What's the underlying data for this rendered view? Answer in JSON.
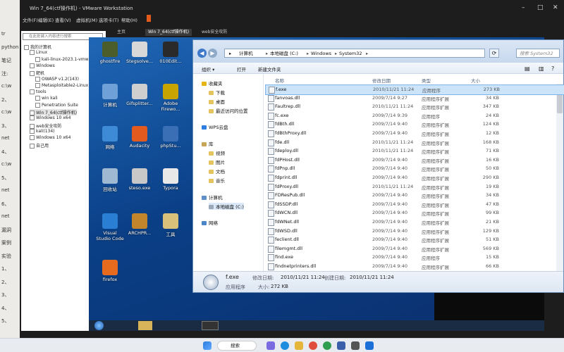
{
  "host_left": {
    "lines": [
      "tr",
      "python pc",
      "笔记",
      "注:",
      "c:\\w",
      "2、",
      "c:\\w",
      "3、",
      "net",
      "4、",
      "c:\\w",
      "5、",
      "net",
      "6、",
      "net",
      "漏洞",
      "案例",
      "实验",
      "1、",
      "2、",
      "3、",
      "4、",
      "5、"
    ]
  },
  "vmware": {
    "title": "Win 7_64(ctf操作机) - VMware Workstation",
    "menu": [
      "文件(F)",
      "编辑(E)",
      "查看(V)",
      "虚拟机(M)",
      "选项卡(T)",
      "帮助(H)"
    ],
    "library_search_placeholder": "在此处键入内容进行搜索",
    "tree": [
      {
        "label": "我的计算机",
        "level": 0
      },
      {
        "label": "Linux",
        "level": 1
      },
      {
        "label": "kali-linux-2023.1-vmware-amd",
        "level": 2
      },
      {
        "label": "Windows",
        "level": 1
      },
      {
        "label": "靶机",
        "level": 1
      },
      {
        "label": "OWASP v1.2(143)",
        "level": 2
      },
      {
        "label": "Metasploitable2-Linux",
        "level": 2
      },
      {
        "label": "tools",
        "level": 1
      },
      {
        "label": "win kali",
        "level": 2
      },
      {
        "label": "Penetration Suite",
        "level": 2
      },
      {
        "label": "Win 7_64(ctf操作机)",
        "level": 1
      },
      {
        "label": "Windows 10 x64",
        "level": 1
      },
      {
        "label": "web安全攻防",
        "level": 1
      },
      {
        "label": "kali(134)",
        "level": 1
      },
      {
        "label": "Windows 10 x64",
        "level": 1
      },
      {
        "label": "自己用",
        "level": 1
      }
    ],
    "tabs": [
      "主页",
      "Win 7_64(ctf操作机)",
      "web安全攻防"
    ]
  },
  "desktop_icons": [
    {
      "label": "ghostfire",
      "color": "#4a5d2a"
    },
    {
      "label": "Stegsolve...",
      "color": "#d8d8d8"
    },
    {
      "label": "010Edit...",
      "color": "#2a2a2a"
    },
    {
      "label": "计算机",
      "color": "#6fa0d8"
    },
    {
      "label": "Gifsplitter...",
      "color": "#cfcfcf"
    },
    {
      "label": "Adobe Firewo...",
      "color": "#c8a400"
    },
    {
      "label": "网络",
      "color": "#3d8ad6"
    },
    {
      "label": "Audacity",
      "color": "#e35a1f"
    },
    {
      "label": "phpStu...",
      "color": "#3b6fb5"
    },
    {
      "label": "回收站",
      "color": "#9fb9d3"
    },
    {
      "label": "steso.exe",
      "color": "#c8c8c8"
    },
    {
      "label": "Typora",
      "color": "#e8e8e8"
    },
    {
      "label": "Visual Studio Code",
      "color": "#2a7fd4"
    },
    {
      "label": "ARCHPR...",
      "color": "#c2852c"
    },
    {
      "label": "工具",
      "color": "#d7c17a"
    },
    {
      "label": "firefox",
      "color": "#e66b1f"
    }
  ],
  "explorer": {
    "address": [
      "计算机",
      "本地磁盘 (C:)",
      "Windows",
      "System32"
    ],
    "search_placeholder": "搜索 System32",
    "toolbar": {
      "organize": "组织 ▾",
      "open": "打开",
      "new_folder": "新建文件夹"
    },
    "nav": [
      {
        "label": "收藏夹",
        "kind": "star"
      },
      {
        "label": "下载",
        "kind": "folder"
      },
      {
        "label": "桌面",
        "kind": "folder"
      },
      {
        "label": "最近访问的位置",
        "kind": "folder"
      },
      {
        "label": "WPS云盘",
        "kind": "cloud"
      },
      {
        "label": "库",
        "kind": "lib"
      },
      {
        "label": "视频",
        "kind": "folder"
      },
      {
        "label": "图片",
        "kind": "folder"
      },
      {
        "label": "文档",
        "kind": "folder"
      },
      {
        "label": "音乐",
        "kind": "folder"
      },
      {
        "label": "计算机",
        "kind": "pc"
      },
      {
        "label": "本地磁盘 (C:)",
        "kind": "drive"
      },
      {
        "label": "网络",
        "kind": "net"
      }
    ],
    "columns": [
      "名称",
      "修改日期",
      "类型",
      "大小"
    ],
    "files": [
      {
        "name": "f.exe",
        "date": "2010/11/21 11:24",
        "type": "应用程序",
        "size": "273 KB"
      },
      {
        "name": "fanvoas.dll",
        "date": "2009/7/14 9:27",
        "type": "应用程序扩展",
        "size": "34 KB"
      },
      {
        "name": "Faultrep.dll",
        "date": "2010/11/21 11:24",
        "type": "应用程序扩展",
        "size": "347 KB"
      },
      {
        "name": "fc.exe",
        "date": "2009/7/14 9:39",
        "type": "应用程序",
        "size": "24 KB"
      },
      {
        "name": "fdBth.dll",
        "date": "2009/7/14 9:40",
        "type": "应用程序扩展",
        "size": "124 KB"
      },
      {
        "name": "fdBthProxy.dll",
        "date": "2009/7/14 9:40",
        "type": "应用程序扩展",
        "size": "12 KB"
      },
      {
        "name": "fde.dll",
        "date": "2010/11/21 11:24",
        "type": "应用程序扩展",
        "size": "168 KB"
      },
      {
        "name": "fdeploy.dll",
        "date": "2010/11/21 11:24",
        "type": "应用程序扩展",
        "size": "71 KB"
      },
      {
        "name": "fdPHost.dll",
        "date": "2009/7/14 9:40",
        "type": "应用程序扩展",
        "size": "16 KB"
      },
      {
        "name": "fdPnp.dll",
        "date": "2009/7/14 9:40",
        "type": "应用程序扩展",
        "size": "50 KB"
      },
      {
        "name": "fdprint.dll",
        "date": "2009/7/14 9:40",
        "type": "应用程序扩展",
        "size": "290 KB"
      },
      {
        "name": "fdProxy.dll",
        "date": "2010/11/21 11:24",
        "type": "应用程序扩展",
        "size": "19 KB"
      },
      {
        "name": "FDResPub.dll",
        "date": "2009/7/14 9:40",
        "type": "应用程序扩展",
        "size": "34 KB"
      },
      {
        "name": "fdSSDP.dll",
        "date": "2009/7/14 9:40",
        "type": "应用程序扩展",
        "size": "47 KB"
      },
      {
        "name": "fdWCN.dll",
        "date": "2009/7/14 9:40",
        "type": "应用程序扩展",
        "size": "99 KB"
      },
      {
        "name": "fdWNet.dll",
        "date": "2009/7/14 9:40",
        "type": "应用程序扩展",
        "size": "21 KB"
      },
      {
        "name": "fdWSD.dll",
        "date": "2009/7/14 9:40",
        "type": "应用程序扩展",
        "size": "129 KB"
      },
      {
        "name": "feclient.dll",
        "date": "2009/7/14 9:40",
        "type": "应用程序扩展",
        "size": "51 KB"
      },
      {
        "name": "filemgmt.dll",
        "date": "2009/7/14 9:40",
        "type": "应用程序扩展",
        "size": "569 KB"
      },
      {
        "name": "find.exe",
        "date": "2009/7/14 9:40",
        "type": "应用程序",
        "size": "15 KB"
      },
      {
        "name": "findnetprinters.dll",
        "date": "2009/7/14 9:40",
        "type": "应用程序扩展",
        "size": "66 KB"
      }
    ],
    "details": {
      "name": "f.exe",
      "modified_label": "修改日期:",
      "modified": "2010/11/21 11:24",
      "created_label": "创建日期:",
      "created": "2010/11/21 11:24",
      "type": "应用程序",
      "size_label": "大小:",
      "size": "272 KB"
    }
  },
  "host_taskbar": {
    "search": "搜索"
  }
}
